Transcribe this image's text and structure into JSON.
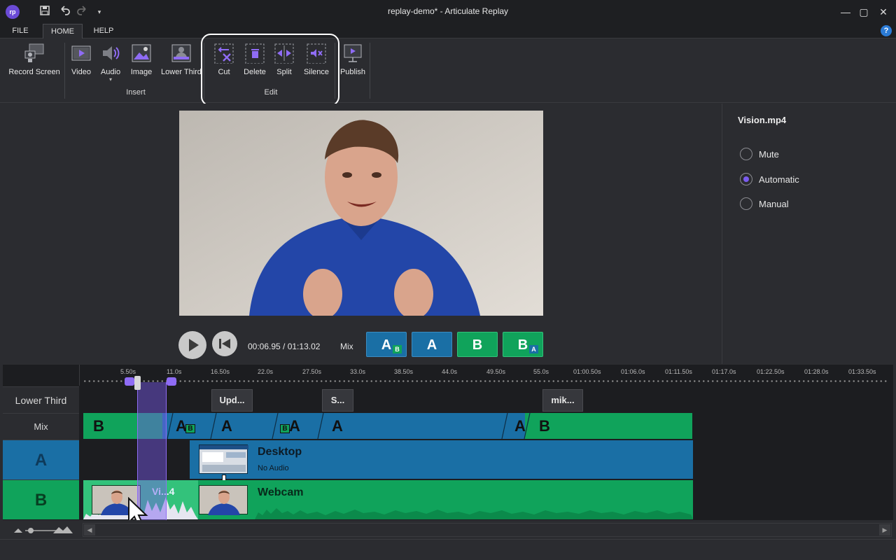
{
  "window": {
    "title": "replay-demo* -  Articulate Replay",
    "logo": "rp",
    "quick_access": [
      "save-icon",
      "undo-icon",
      "redo-icon",
      "customize-icon"
    ],
    "controls": [
      "minimize-icon",
      "maximize-icon",
      "close-icon"
    ]
  },
  "ribbon": {
    "tabs": [
      {
        "label": "FILE"
      },
      {
        "label": "HOME",
        "active": true
      },
      {
        "label": "HELP"
      }
    ],
    "help_icon": "?",
    "buttons": {
      "record_screen": "Record Screen",
      "video": "Video",
      "audio": "Audio",
      "image": "Image",
      "lower_third": "Lower Third",
      "cut": "Cut",
      "delete": "Delete",
      "split": "Split",
      "silence": "Silence",
      "publish": "Publish"
    },
    "groups": {
      "insert": "Insert",
      "edit": "Edit"
    }
  },
  "player": {
    "time": "00:06.95 / 01:13.02",
    "mix_label": "Mix",
    "mix_buttons": [
      {
        "letter": "A",
        "badge": "B"
      },
      {
        "letter": "A",
        "badge": ""
      },
      {
        "letter": "B",
        "badge": ""
      },
      {
        "letter": "B",
        "badge": "A"
      }
    ],
    "colors": {
      "a": "#1a6fa5",
      "b": "#10a35b",
      "accent": "#7b5cf0"
    }
  },
  "properties": {
    "clip_name": "Vision.mp4",
    "options": [
      {
        "label": "Mute",
        "selected": false
      },
      {
        "label": "Automatic",
        "selected": true
      },
      {
        "label": "Manual",
        "selected": false
      }
    ]
  },
  "timeline": {
    "ruler_ticks": [
      "5.50s",
      "11.0s",
      "16.50s",
      "22.0s",
      "27.50s",
      "33.0s",
      "38.50s",
      "44.0s",
      "49.50s",
      "55.0s",
      "01:00.50s",
      "01:06.0s",
      "01:11.50s",
      "01:17.0s",
      "01:22.50s",
      "01:28.0s",
      "01:33.50s"
    ],
    "track_labels": {
      "lower_third": "Lower Third",
      "mix": "Mix",
      "a": "A",
      "b": "B"
    },
    "lower_third_clips": [
      "Upd...",
      "S...",
      "mik..."
    ],
    "mix_segments": [
      "B",
      "A",
      "B",
      "A",
      "B",
      "A",
      "A",
      "A",
      "B"
    ],
    "track_a_clip": {
      "title": "Desktop",
      "subtitle": "No Audio"
    },
    "track_b_clips": [
      {
        "title": "Vi...4"
      },
      {
        "title": "Webcam"
      }
    ]
  }
}
